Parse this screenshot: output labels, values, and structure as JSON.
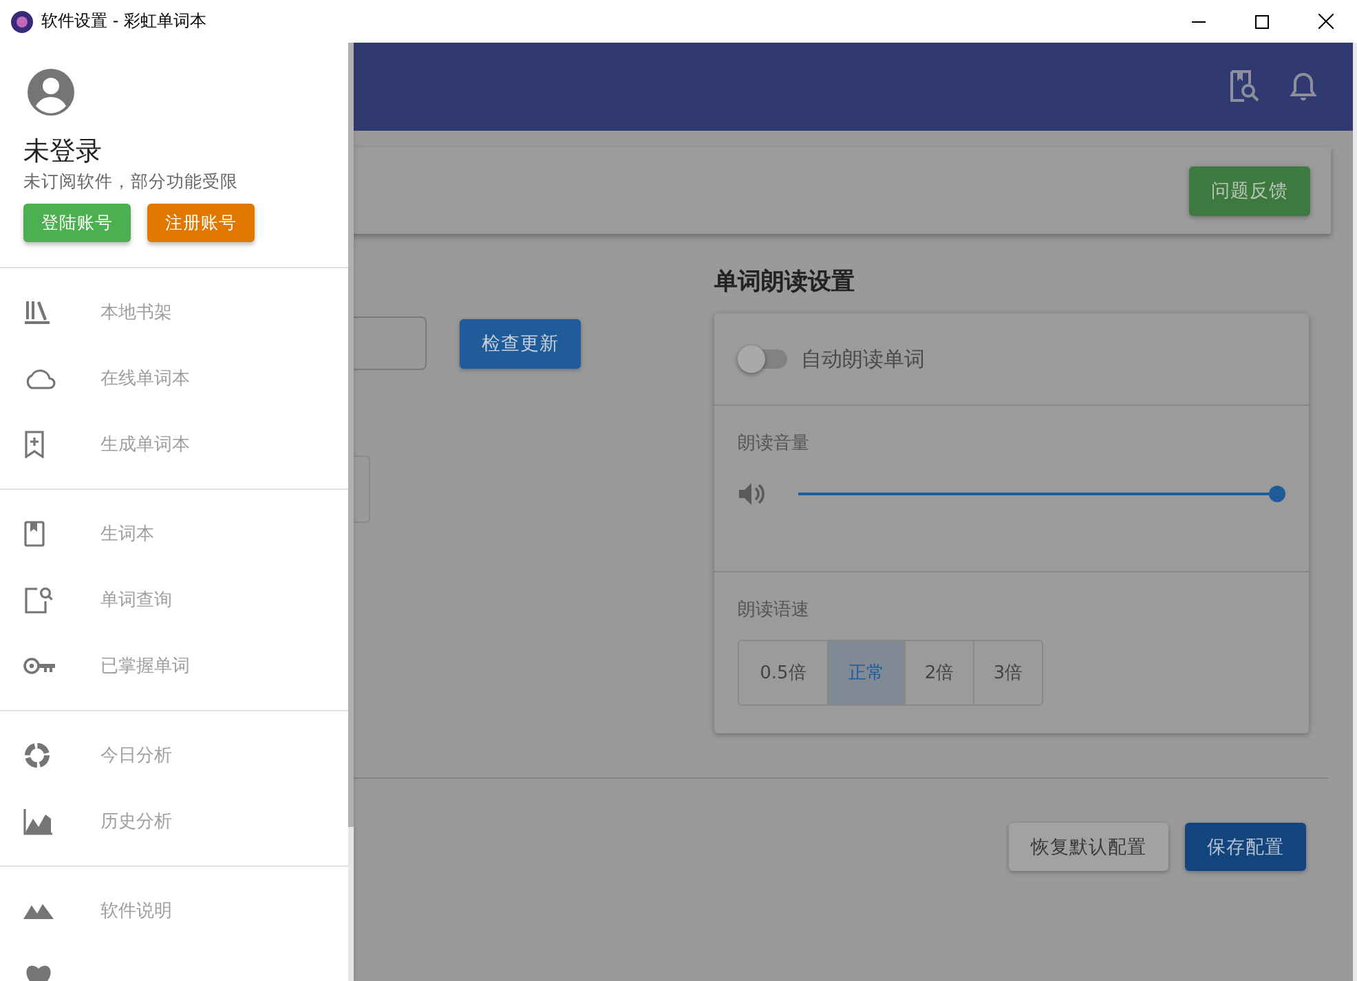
{
  "window": {
    "title": "软件设置 - 彩虹单词本"
  },
  "drawer": {
    "user": {
      "name": "未登录",
      "note": "未订阅软件，部分功能受限"
    },
    "buttons": [
      {
        "label": "登陆账号",
        "kind": "login"
      },
      {
        "label": "注册账号",
        "kind": "register"
      }
    ],
    "groups": [
      [
        {
          "kind": "shelf",
          "label": "本地书架"
        },
        {
          "kind": "cloud",
          "label": "在线单词本"
        },
        {
          "kind": "bookmark",
          "label": "生成单词本"
        }
      ],
      [
        {
          "kind": "book",
          "label": "生词本"
        },
        {
          "kind": "lookup",
          "label": "单词查询"
        },
        {
          "kind": "key",
          "label": "已掌握单词"
        }
      ],
      [
        {
          "kind": "ring",
          "label": "今日分析"
        },
        {
          "kind": "chart",
          "label": "历史分析"
        }
      ],
      [
        {
          "kind": "mountains",
          "label": "软件说明"
        },
        {
          "kind": "heart"
        }
      ]
    ]
  },
  "toolbar": {
    "feedback": "问题反馈"
  },
  "update": {
    "button": "检查更新"
  },
  "reading": {
    "title": "单词朗读设置",
    "auto_read": {
      "label": "自动朗读单词",
      "on": false
    },
    "volume": {
      "label": "朗读音量",
      "level": 1
    },
    "speed": {
      "label": "朗读语速",
      "options": [
        {
          "label": "0.5倍",
          "selected": false
        },
        {
          "label": "正常",
          "selected": true
        },
        {
          "label": "2倍",
          "selected": false
        },
        {
          "label": "3倍",
          "selected": false
        }
      ]
    }
  },
  "footer": {
    "buttons": [
      {
        "label": "恢复默认配置",
        "kind": "reset"
      },
      {
        "label": "保存配置",
        "kind": "save"
      }
    ]
  }
}
